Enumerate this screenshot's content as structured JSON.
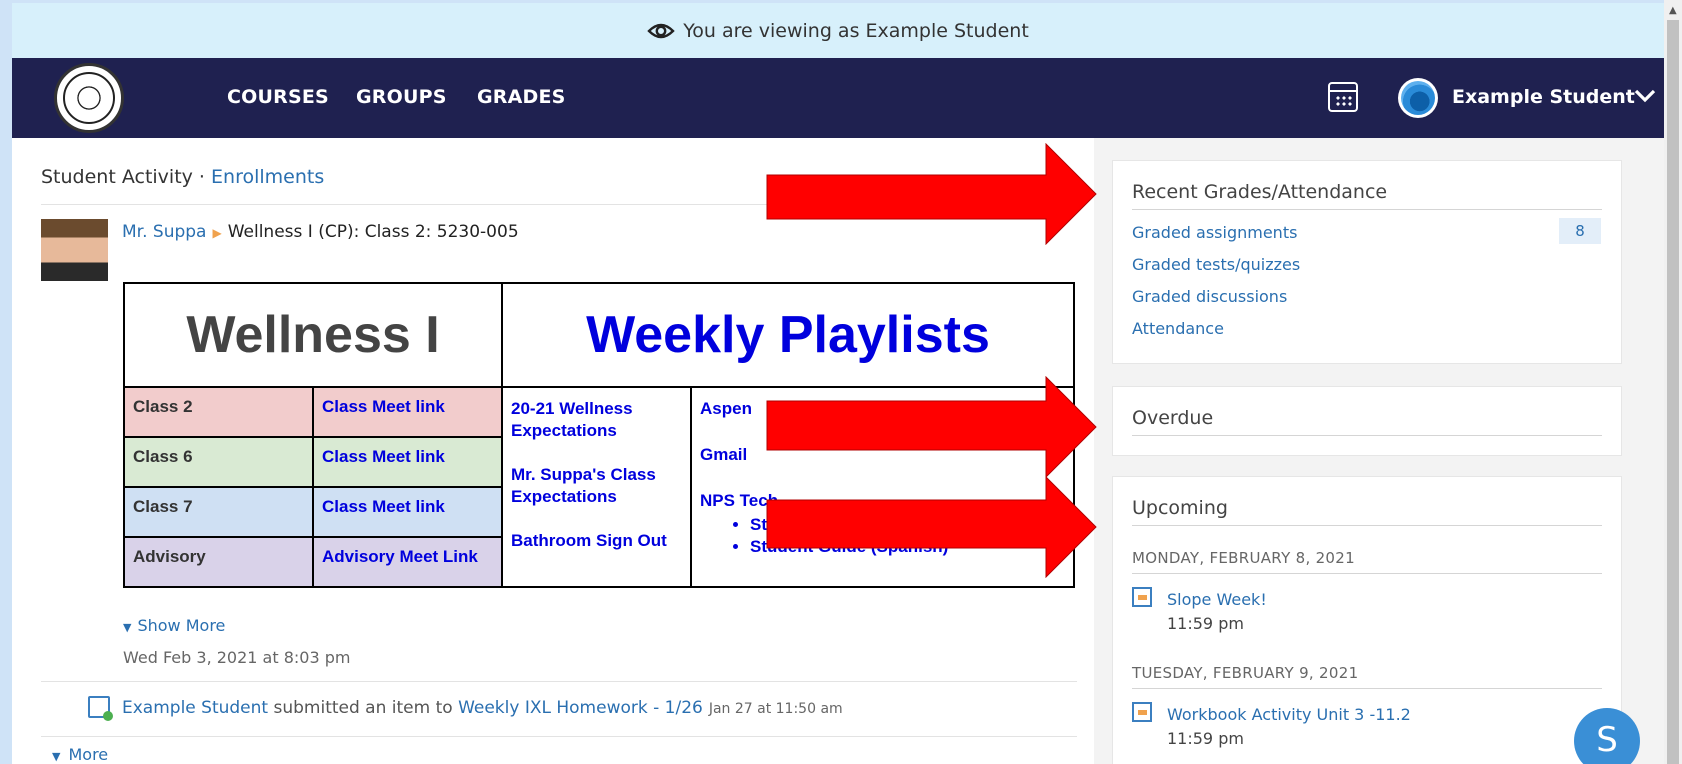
{
  "viewing_banner": {
    "text": "You are viewing as Example Student"
  },
  "nav": {
    "links": [
      "COURSES",
      "GROUPS",
      "GRADES"
    ],
    "user_name": "Example Student"
  },
  "activity": {
    "heading": "Student Activity · ",
    "heading_link": "Enrollments",
    "post": {
      "author": "Mr. Suppa",
      "course": "Wellness I (CP): Class 2: 5230-005",
      "show_more": "Show More",
      "timestamp": "Wed Feb 3, 2021 at 8:03 pm"
    },
    "playlist": {
      "title_left": "Wellness I",
      "title_right": "Weekly Playlists",
      "rows": [
        {
          "class": "Class 2",
          "link": "Class Meet link"
        },
        {
          "class": "Class 6",
          "link": "Class Meet link"
        },
        {
          "class": "Class 7",
          "link": "Class Meet link"
        },
        {
          "class": "Advisory",
          "link": "Advisory Meet Link"
        }
      ],
      "expectations": [
        "20-21 Wellness Expectations",
        "Mr. Suppa's Class Expectations",
        "Bathroom Sign Out"
      ],
      "tools": [
        "Aspen",
        "Gmail",
        "NPS Tech"
      ],
      "tools_sub": [
        "St",
        "Student Guide (Spanish)"
      ]
    },
    "submission": {
      "student": "Example Student",
      "middle": " submitted an item to ",
      "assignment": "Weekly IXL Homework - 1/26",
      "when": "Jan 27 at 11:50 am"
    },
    "more": "More"
  },
  "sidebar": {
    "recent": {
      "title": "Recent Grades/Attendance",
      "links": [
        "Graded assignments",
        "Graded tests/quizzes",
        "Graded discussions",
        "Attendance"
      ],
      "badge": "8"
    },
    "overdue": {
      "title": "Overdue"
    },
    "upcoming": {
      "title": "Upcoming",
      "days": [
        {
          "date": "MONDAY, FEBRUARY 8, 2021",
          "item": "Slope Week!",
          "time": "11:59 pm"
        },
        {
          "date": "TUESDAY, FEBRUARY 9, 2021",
          "item": "Workbook Activity Unit 3 -11.2",
          "time": "11:59 pm"
        }
      ]
    }
  },
  "chat": {
    "letter": "S"
  },
  "colors": {
    "nav_bg": "#1f2150",
    "banner_bg": "#d7f0fb",
    "link": "#2a6fb0",
    "arrow": "#ff0000"
  },
  "icons": [
    "eye-icon",
    "calendar-icon",
    "avatar",
    "chevron-down-icon",
    "assignment-icon",
    "submission-icon"
  ]
}
